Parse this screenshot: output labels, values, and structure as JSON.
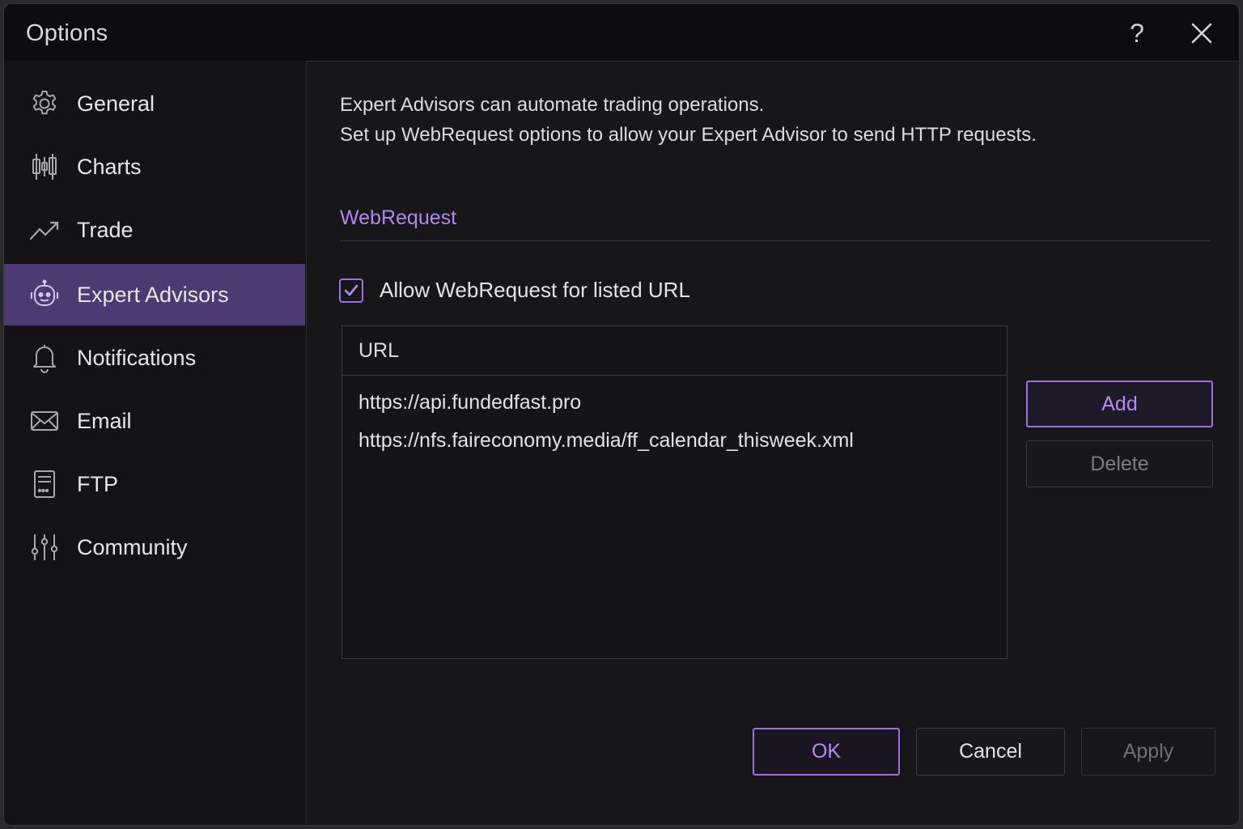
{
  "window": {
    "title": "Options",
    "help_icon": "question-mark-icon",
    "close_icon": "close-icon"
  },
  "sidebar": {
    "items": [
      {
        "label": "General",
        "icon": "gear-icon"
      },
      {
        "label": "Charts",
        "icon": "candlestick-icon"
      },
      {
        "label": "Trade",
        "icon": "trend-line-icon"
      },
      {
        "label": "Expert Advisors",
        "icon": "robot-icon",
        "active": true
      },
      {
        "label": "Notifications",
        "icon": "bell-icon"
      },
      {
        "label": "Email",
        "icon": "envelope-icon"
      },
      {
        "label": "FTP",
        "icon": "server-icon"
      },
      {
        "label": "Community",
        "icon": "sliders-icon"
      }
    ]
  },
  "main": {
    "intro_line1": "Expert Advisors can automate trading operations.",
    "intro_line2": "Set up WebRequest options to allow your Expert Advisor to send HTTP requests.",
    "section_title": "WebRequest",
    "allow_checkbox": {
      "label": "Allow WebRequest for listed URL",
      "checked": true
    },
    "url_table": {
      "header": "URL",
      "rows": [
        "https://api.fundedfast.pro",
        "https://nfs.faireconomy.media/ff_calendar_thisweek.xml"
      ]
    },
    "add_label": "Add",
    "delete_label": "Delete"
  },
  "footer": {
    "ok_label": "OK",
    "cancel_label": "Cancel",
    "apply_label": "Apply"
  },
  "colors": {
    "accent": "#9d6fe0",
    "accent_text": "#b285f0",
    "active_nav": "#4d3a72",
    "background": "#17171a"
  }
}
